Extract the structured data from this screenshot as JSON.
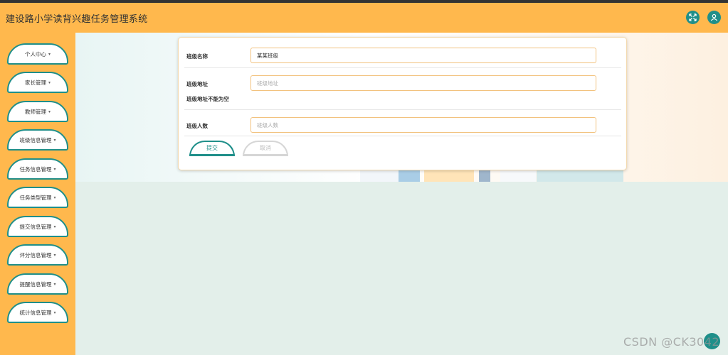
{
  "app": {
    "title": "建设路小学读背兴趣任务管理系统"
  },
  "header": {
    "icons": [
      "fullscreen-icon",
      "user-icon"
    ]
  },
  "sidebar": {
    "items": [
      {
        "label": "个人中心"
      },
      {
        "label": "家长管理"
      },
      {
        "label": "教师管理"
      },
      {
        "label": "班级信息管理"
      },
      {
        "label": "任务信息管理"
      },
      {
        "label": "任务类型管理"
      },
      {
        "label": "提交信息管理"
      },
      {
        "label": "评分信息管理"
      },
      {
        "label": "提醒信息管理"
      },
      {
        "label": "统计信息管理"
      }
    ],
    "caret": "▾"
  },
  "form": {
    "class_name": {
      "label": "班级名称",
      "value": "某某班级",
      "placeholder": ""
    },
    "class_address": {
      "label": "班级地址",
      "value": "",
      "placeholder": "班级地址",
      "error": "班级地址不能为空"
    },
    "class_size": {
      "label": "班级人数",
      "value": "",
      "placeholder": "班级人数"
    },
    "submit_label": "提交",
    "cancel_label": "取消"
  },
  "watermark": "CSDN @CK3042",
  "colors": {
    "header_bg": "#ffb84d",
    "accent": "#1f8f8a",
    "content_bg": "#e3efea"
  }
}
